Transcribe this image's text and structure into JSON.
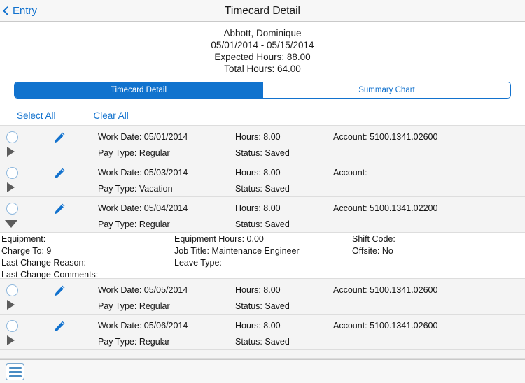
{
  "navbar": {
    "back_label": "Entry",
    "back_icon": "chevron-left-icon",
    "title": "Timecard Detail"
  },
  "summary": {
    "employee_name": "Abbott, Dominique",
    "date_range": "05/01/2014 - 05/15/2014",
    "expected_hours": "Expected Hours: 88.00",
    "total_hours": "Total Hours: 64.00"
  },
  "segmented_control": {
    "active_index": 0,
    "segments": [
      {
        "label": "Timecard Detail"
      },
      {
        "label": "Summary Chart"
      }
    ],
    "active_color": "#1173ce",
    "accent_color": "#1272ce"
  },
  "actions": {
    "select_all_label": "Select All",
    "clear_all_label": "Clear All"
  },
  "rows": [
    {
      "work_date": "Work Date: 05/01/2014",
      "hours": "Hours: 8.00",
      "account": "Account: 5100.1341.02600",
      "pay_type": "Pay Type:  Regular",
      "status": "Status: Saved",
      "expanded": false,
      "checked": false
    },
    {
      "work_date": "Work Date: 05/03/2014",
      "hours": "Hours: 8.00",
      "account": "Account:",
      "pay_type": "Pay Type:  Vacation",
      "status": "Status: Saved",
      "expanded": false,
      "checked": false
    },
    {
      "work_date": "Work Date: 05/04/2014",
      "hours": "Hours: 8.00",
      "account": "Account: 5100.1341.02200",
      "pay_type": "Pay Type:  Regular",
      "status": "Status: Saved",
      "expanded": true,
      "checked": false
    },
    {
      "work_date": "Work Date: 05/05/2014",
      "hours": "Hours: 8.00",
      "account": "Account: 5100.1341.02600",
      "pay_type": "Pay Type:  Regular",
      "status": "Status: Saved",
      "expanded": false,
      "checked": false
    },
    {
      "work_date": "Work Date: 05/06/2014",
      "hours": "Hours: 8.00",
      "account": "Account: 5100.1341.02600",
      "pay_type": "Pay Type:  Regular",
      "status": "Status: Saved",
      "expanded": false,
      "checked": false
    }
  ],
  "expanded_detail": {
    "equipment": "Equipment:",
    "charge_to": "Charge To: 9",
    "last_change_reason": "Last Change Reason:",
    "last_change_comments": "Last Change Comments:",
    "equipment_hours": "Equipment Hours: 0.00",
    "job_title": "Job Title: Maintenance Engineer",
    "leave_type": "Leave Type:",
    "shift_code": "Shift Code:",
    "offsite": "Offsite: No"
  },
  "toolbar": {
    "menu_icon": "hamburger-menu-icon"
  }
}
